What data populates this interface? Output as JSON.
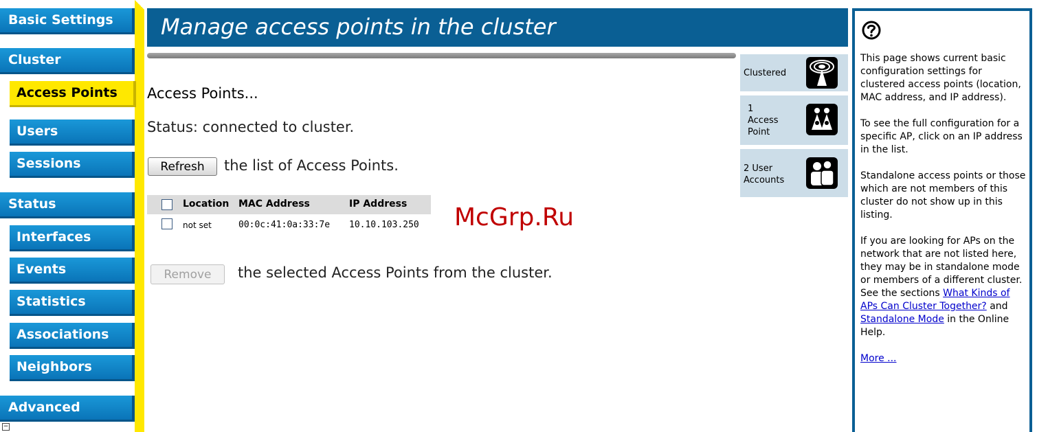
{
  "sidebar": {
    "items": [
      {
        "label": "Basic Settings"
      },
      {
        "label": "Cluster"
      },
      {
        "label": "Access Points"
      },
      {
        "label": "Users"
      },
      {
        "label": "Sessions"
      },
      {
        "label": "Status"
      },
      {
        "label": "Interfaces"
      },
      {
        "label": "Events"
      },
      {
        "label": "Statistics"
      },
      {
        "label": "Associations"
      },
      {
        "label": "Neighbors"
      },
      {
        "label": "Advanced"
      }
    ],
    "active_item": "Access Points",
    "minus_glyph": "−"
  },
  "header": {
    "title": "Manage access points in the cluster"
  },
  "main": {
    "section_title": "Access Points...",
    "status_text": "Status: connected to cluster.",
    "refresh_button": "Refresh",
    "refresh_suffix": "the list of Access Points.",
    "table": {
      "columns": [
        "Location",
        "MAC Address",
        "IP Address"
      ],
      "rows": [
        {
          "location": "not set",
          "mac": "00:0c:41:0a:33:7e",
          "ip": "10.10.103.250"
        }
      ]
    },
    "remove_button": "Remove",
    "remove_suffix": "the selected Access Points from the cluster."
  },
  "watermark": "McGrp.Ru",
  "status_tiles": [
    {
      "label": "Clustered",
      "icon": "clustered-antenna-icon"
    },
    {
      "label": "1\nAccess\nPoint",
      "icon": "access-point-people-icon"
    },
    {
      "label": "2 User\nAccounts",
      "icon": "user-accounts-icon"
    }
  ],
  "help": {
    "icon": "question-mark-icon",
    "p1": "This page shows current basic configuration settings for clustered access points (location, MAC address, and IP address).",
    "p2": "To see the full configuration for a specific AP, click on an IP address in the list.",
    "p3": "Standalone access points or those which are not members of this cluster do not show up in this listing.",
    "p4_before": "If you are looking for APs on the network that are not listed here, they may be in standalone mode or members of a different cluster. See the sections",
    "link1": "What Kinds of APs Can Cluster Together?",
    "p4_and": "and",
    "link2": "Standalone Mode",
    "p4_after": "in the Online Help.",
    "more_link": "More ..."
  },
  "colors": {
    "nav_blue": "#0a74b8",
    "header_blue": "#0a5f94",
    "active_yellow": "#ffe800",
    "tile_bg": "#ccdde8",
    "watermark_red": "#c00000"
  }
}
